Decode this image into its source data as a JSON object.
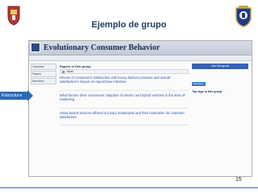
{
  "slide": {
    "title": "Ejemplo de grupo",
    "page_number": "15",
    "callout": "Estructura"
  },
  "app": {
    "group_title": "Evolutionary Consumer Behavior",
    "sidebar": {
      "items": [
        {
          "label": "Overview"
        },
        {
          "label": "Papers"
        },
        {
          "label": "Members"
        }
      ]
    },
    "main": {
      "heading": "Papers in this group",
      "toolbar_label": "Mark"
    },
    "right": {
      "join_button": "Join this group",
      "members_pill": "Members",
      "tags_heading": "Top tags in this group"
    }
  },
  "papers": [
    {
      "title": "Drivers of consumer's satisfaction with luxury fashion products and overall satisfaction's impact on repurchase intention"
    },
    {
      "title": "What factors drive consumers' adoption of electric and hybrid vehicles in the area of marketing"
    },
    {
      "title": "Value-based services offered in luxury restaurants and their motivation for customer satisfaction"
    }
  ],
  "colors": {
    "accent": "#2b6ab8",
    "title": "#1f3a5f",
    "link": "#2a56a8"
  }
}
